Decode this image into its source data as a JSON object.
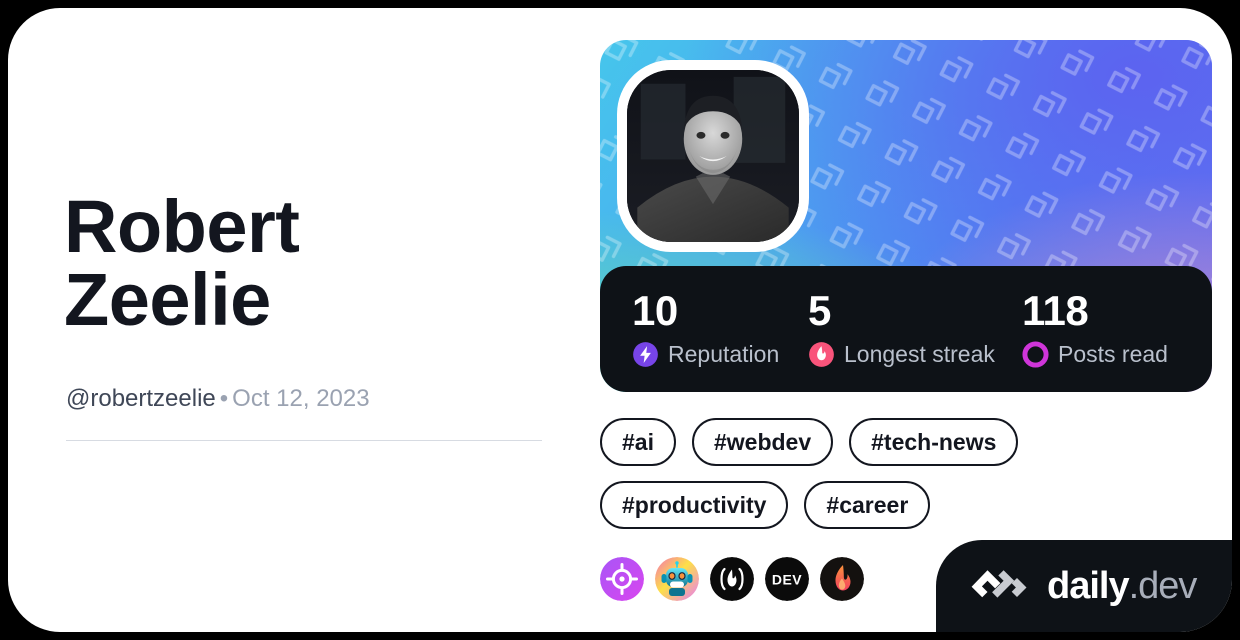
{
  "card": {
    "background_color": "#ffffff",
    "page_background_color": "#000000"
  },
  "profile": {
    "name": "Robert\nZeelie",
    "handle": "@robertzeelie",
    "separator": "•",
    "date": "Oct 12, 2023",
    "avatar_alt": "profile-photo"
  },
  "stats": [
    {
      "value": "10",
      "label": "Reputation",
      "icon": "reputation-bolt-icon",
      "color": "#7744e8"
    },
    {
      "value": "5",
      "label": "Longest streak",
      "icon": "streak-flame-icon",
      "color": "#f9547b"
    },
    {
      "value": "118",
      "label": "Posts read",
      "icon": "posts-read-ring-icon",
      "color": "#cf35d9"
    }
  ],
  "tags": [
    {
      "label": "#ai"
    },
    {
      "label": "#webdev"
    },
    {
      "label": "#tech-news"
    },
    {
      "label": "#productivity"
    },
    {
      "label": "#career"
    }
  ],
  "sources": [
    {
      "name": "target-crosshair-source-icon"
    },
    {
      "name": "robot-avatar-source-icon"
    },
    {
      "name": "flame-parentheses-source-icon"
    },
    {
      "name": "dev-to-source-icon"
    },
    {
      "name": "orange-flame-source-icon"
    }
  ],
  "brand": {
    "mark": "daily-dev-logo-icon",
    "name": "daily",
    "tld": ".dev"
  }
}
